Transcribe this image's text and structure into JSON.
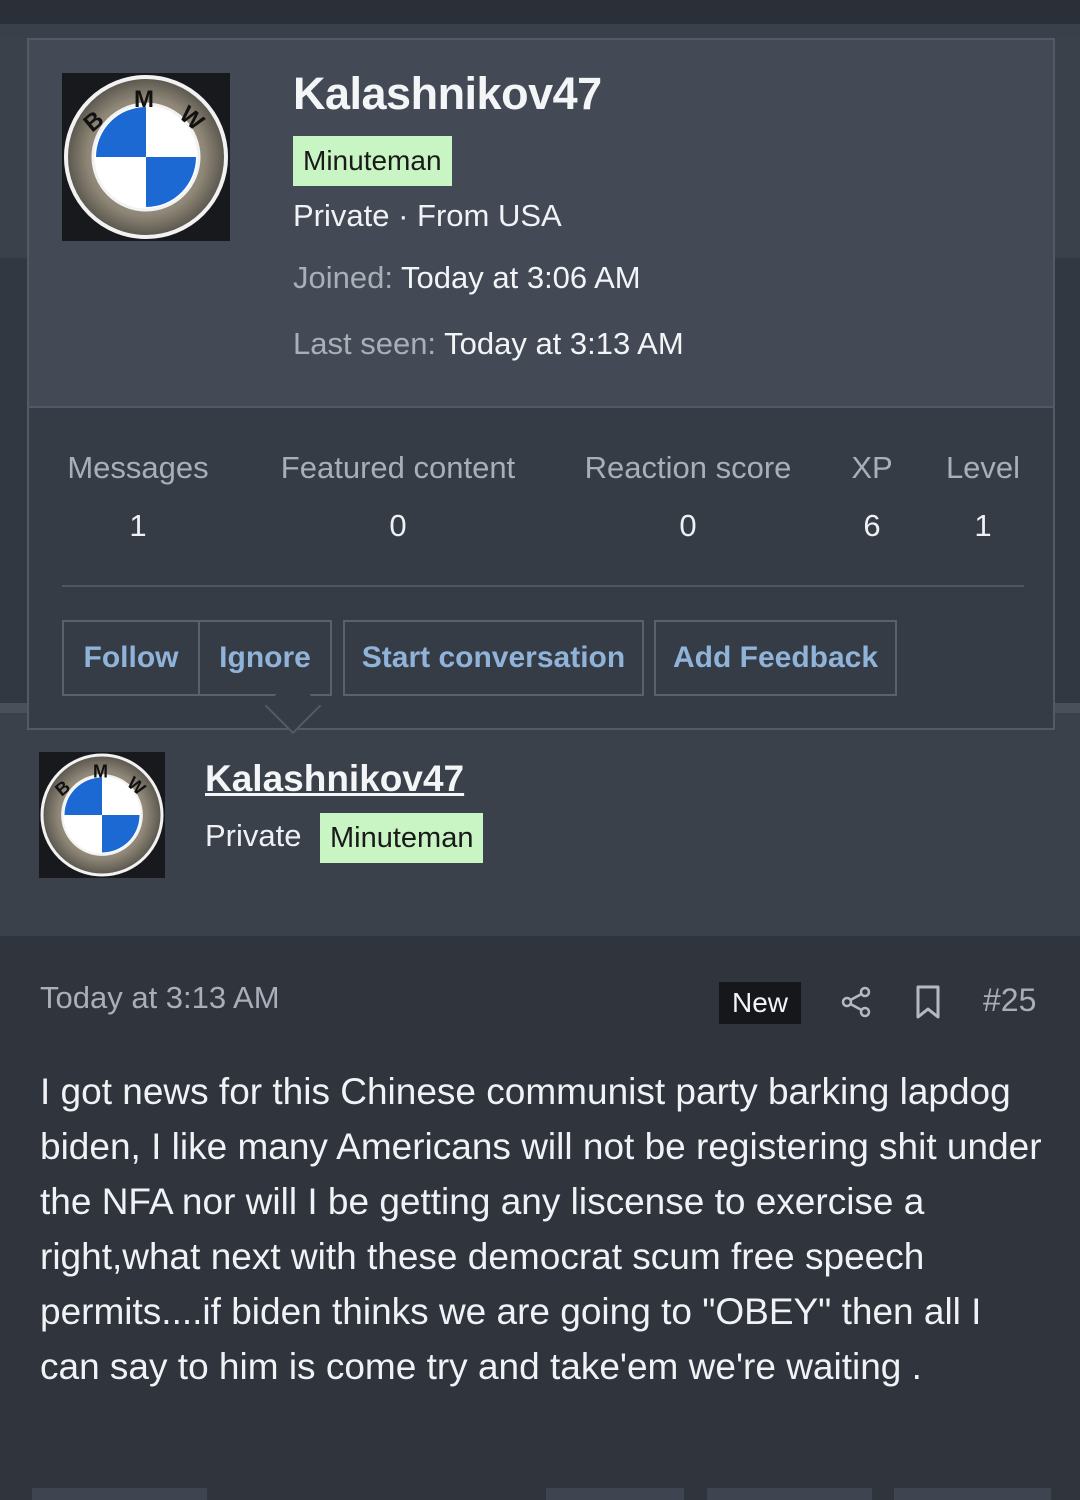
{
  "popup": {
    "username": "Kalashnikov47",
    "badge": "Minuteman",
    "rank_line": "Private · From USA",
    "joined_label": "Joined:",
    "joined_value": "Today at 3:06 AM",
    "seen_label": "Last seen:",
    "seen_value": "Today at 3:13 AM",
    "stats": [
      {
        "label": "Messages",
        "value": "1"
      },
      {
        "label": "Featured content",
        "value": "0"
      },
      {
        "label": "Reaction score",
        "value": "0"
      },
      {
        "label": "XP",
        "value": "6"
      },
      {
        "label": "Level",
        "value": "1"
      }
    ],
    "buttons": {
      "follow": "Follow",
      "ignore": "Ignore",
      "start_conversation": "Start conversation",
      "add_feedback": "Add Feedback"
    }
  },
  "post": {
    "username": "Kalashnikov47",
    "rank": "Private",
    "badge": "Minuteman",
    "time": "Today at 3:13 AM",
    "new_label": "New",
    "number": "#25",
    "body": "I got news for this Chinese communist party barking lapdog biden, I like many Americans will not be registering shit under the NFA nor will I be getting any liscense to exercise a right,what next with these democrat scum free speech permits....if biden thinks we are going to \"OBEY\" then all I can say to him is come try and take'em we're waiting ."
  },
  "colors": {
    "badge_bg": "#c9f5c4",
    "button_text": "#8fb3d9",
    "bmw_blue": "#1c69d4"
  },
  "icons": [
    "bmw-logo-icon",
    "share-icon",
    "bookmark-icon"
  ]
}
